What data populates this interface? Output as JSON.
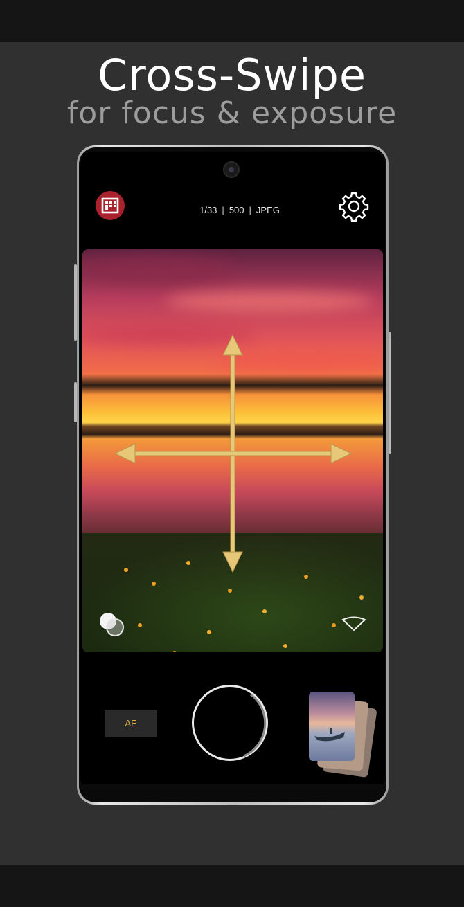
{
  "promo": {
    "title": "Cross-Swipe",
    "subtitle": "for focus & exposure"
  },
  "status_bar": {
    "shutter_speed": "1/33",
    "iso": "500",
    "format": "JPEG"
  },
  "controls": {
    "ae_label": "AE"
  },
  "icons": {
    "app_logo": "filmic-logo-icon",
    "settings": "gear-icon",
    "overlay_toggle": "overlapping-circles-icon",
    "collapse": "chevron-down-icon",
    "gesture": "cross-arrows-icon"
  },
  "colors": {
    "accent_gold": "#d6ac3f",
    "logo_red": "#a9222d",
    "arrow_yellow": "#e6c878"
  }
}
